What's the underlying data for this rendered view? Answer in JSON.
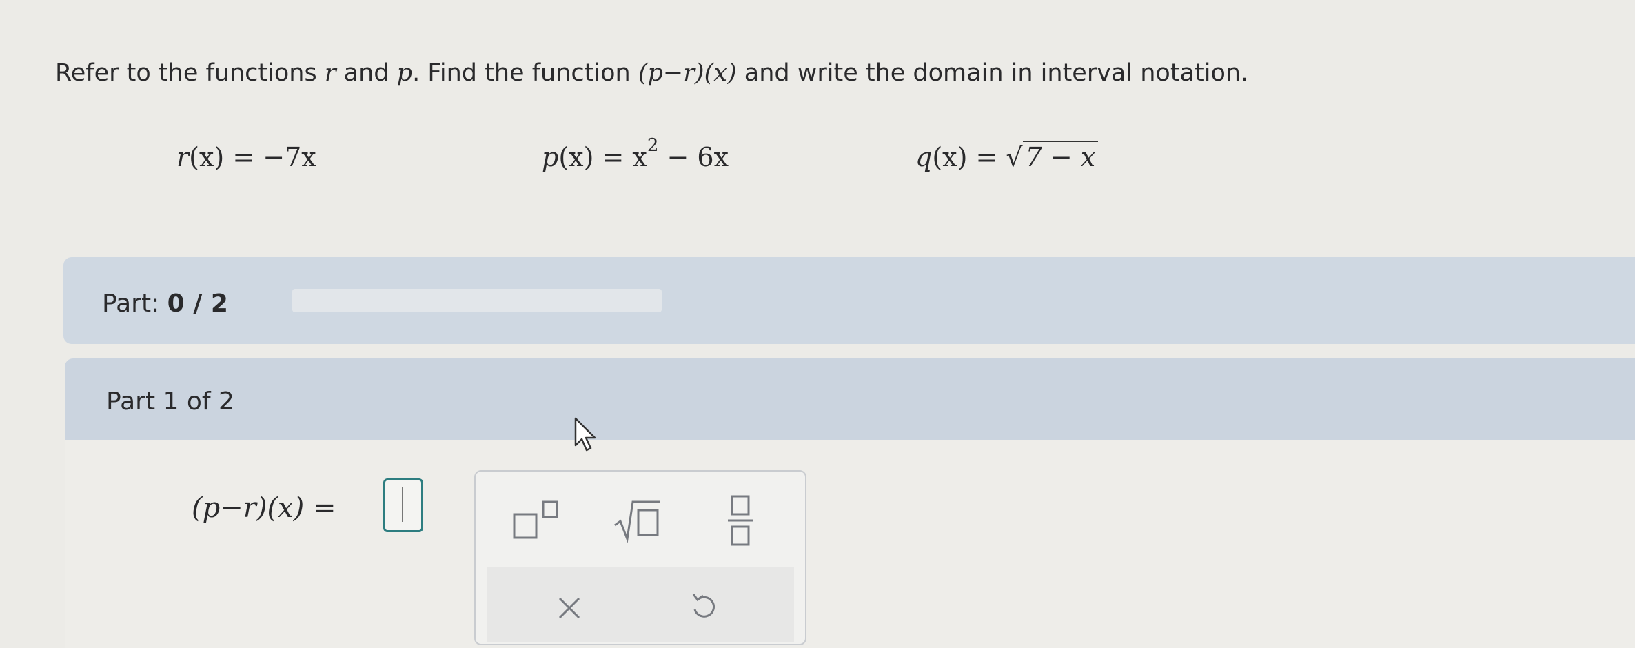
{
  "question": {
    "prefix": "Refer to the functions ",
    "var_r": "r",
    "and": " and ",
    "var_p": "p",
    "mid": ". Find the function ",
    "func_expr": "(p−r)(x)",
    "suffix": " and write the domain in interval notation."
  },
  "functions": {
    "r": {
      "name": "r",
      "arg": "(x)",
      "rhs": " = −7x"
    },
    "p": {
      "name": "p",
      "arg": "(x)",
      "rhs_base": " = x",
      "rhs_exp": "2",
      "rhs_tail": " − 6x"
    },
    "q": {
      "name": "q",
      "arg": "(x)",
      "rhs_eq": " = ",
      "radicand": "7 − x"
    }
  },
  "progress": {
    "label": "Part: ",
    "value": "0 / 2",
    "fraction": 0
  },
  "part": {
    "title": "Part 1 of 2"
  },
  "answer": {
    "lhs": "(p−r)(x)",
    "equals": "=",
    "value": ""
  },
  "toolbar": {
    "tools": [
      "superscript-icon",
      "square-root-icon",
      "fraction-icon",
      "clear-icon",
      "undo-icon"
    ]
  },
  "colors": {
    "accent": "#2d7d80",
    "part_bar": "#cfd8e2",
    "header": "#cbd4df"
  }
}
